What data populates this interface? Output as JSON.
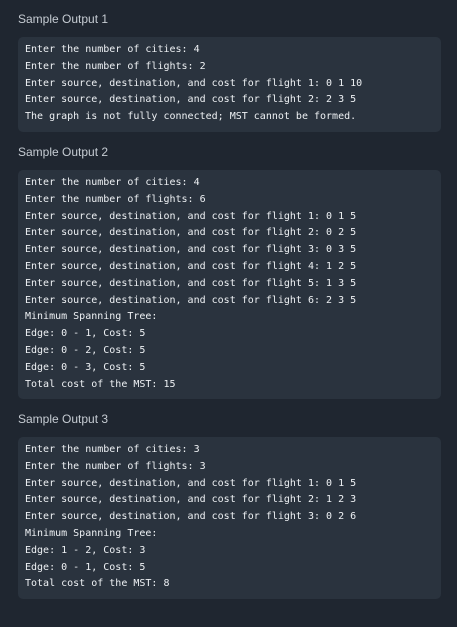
{
  "samples": [
    {
      "title": "Sample Output 1",
      "lines": [
        "Enter the number of cities: 4",
        "Enter the number of flights: 2",
        "Enter source, destination, and cost for flight 1: 0 1 10",
        "Enter source, destination, and cost for flight 2: 2 3 5",
        "The graph is not fully connected; MST cannot be formed."
      ]
    },
    {
      "title": "Sample Output 2",
      "lines": [
        "Enter the number of cities: 4",
        "Enter the number of flights: 6",
        "Enter source, destination, and cost for flight 1: 0 1 5",
        "Enter source, destination, and cost for flight 2: 0 2 5",
        "Enter source, destination, and cost for flight 3: 0 3 5",
        "Enter source, destination, and cost for flight 4: 1 2 5",
        "Enter source, destination, and cost for flight 5: 1 3 5",
        "Enter source, destination, and cost for flight 6: 2 3 5",
        "Minimum Spanning Tree:",
        "Edge: 0 - 1, Cost: 5",
        "Edge: 0 - 2, Cost: 5",
        "Edge: 0 - 3, Cost: 5",
        "Total cost of the MST: 15"
      ]
    },
    {
      "title": "Sample Output 3",
      "lines": [
        "Enter the number of cities: 3",
        "Enter the number of flights: 3",
        "Enter source, destination, and cost for flight 1: 0 1 5",
        "Enter source, destination, and cost for flight 2: 1 2 3",
        "Enter source, destination, and cost for flight 3: 0 2 6",
        "Minimum Spanning Tree:",
        "Edge: 1 - 2, Cost: 3",
        "Edge: 0 - 1, Cost: 5",
        "Total cost of the MST: 8"
      ]
    }
  ]
}
